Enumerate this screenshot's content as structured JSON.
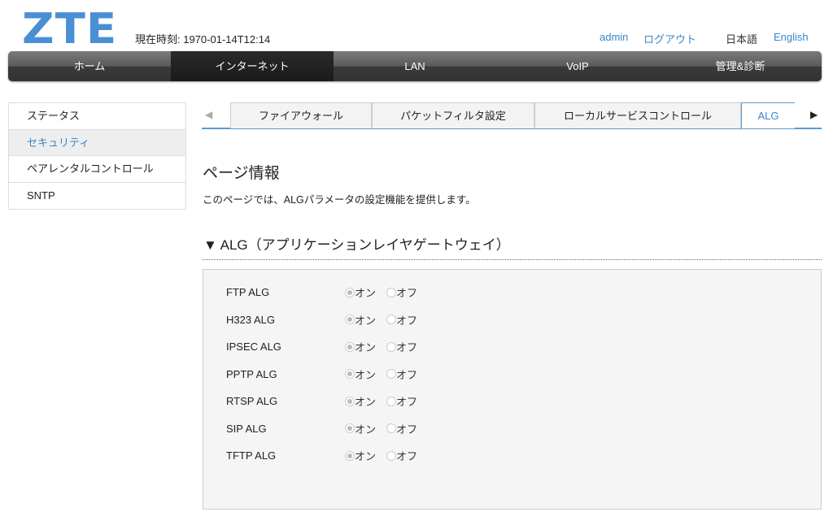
{
  "logo": "ZTE",
  "header": {
    "clock": "現在時刻: 1970-01-14T12:14",
    "user": "admin",
    "logout": "ログアウト",
    "lang_ja": "日本語",
    "lang_en": "English"
  },
  "nav": [
    "ホーム",
    "インターネット",
    "LAN",
    "VoIP",
    "管理&診断"
  ],
  "sidebar": [
    "ステータス",
    "セキュリティ",
    "ペアレンタルコントロール",
    "SNTP"
  ],
  "tabs": [
    "ファイアウォール",
    "パケットフィルタ設定",
    "ローカルサービスコントロール",
    "ALG"
  ],
  "page": {
    "title": "ページ情報",
    "desc": "このページでは、ALGパラメータの設定機能を提供します。",
    "section": "▼ ALG（アプリケーションレイヤゲートウェイ）"
  },
  "options": {
    "on": "オン",
    "off": "オフ"
  },
  "rows": [
    {
      "label": "FTP ALG",
      "value": "on"
    },
    {
      "label": "H323 ALG",
      "value": "on"
    },
    {
      "label": "IPSEC ALG",
      "value": "on"
    },
    {
      "label": "PPTP ALG",
      "value": "on"
    },
    {
      "label": "RTSP ALG",
      "value": "on"
    },
    {
      "label": "SIP ALG",
      "value": "on"
    },
    {
      "label": "TFTP ALG",
      "value": "on"
    }
  ]
}
